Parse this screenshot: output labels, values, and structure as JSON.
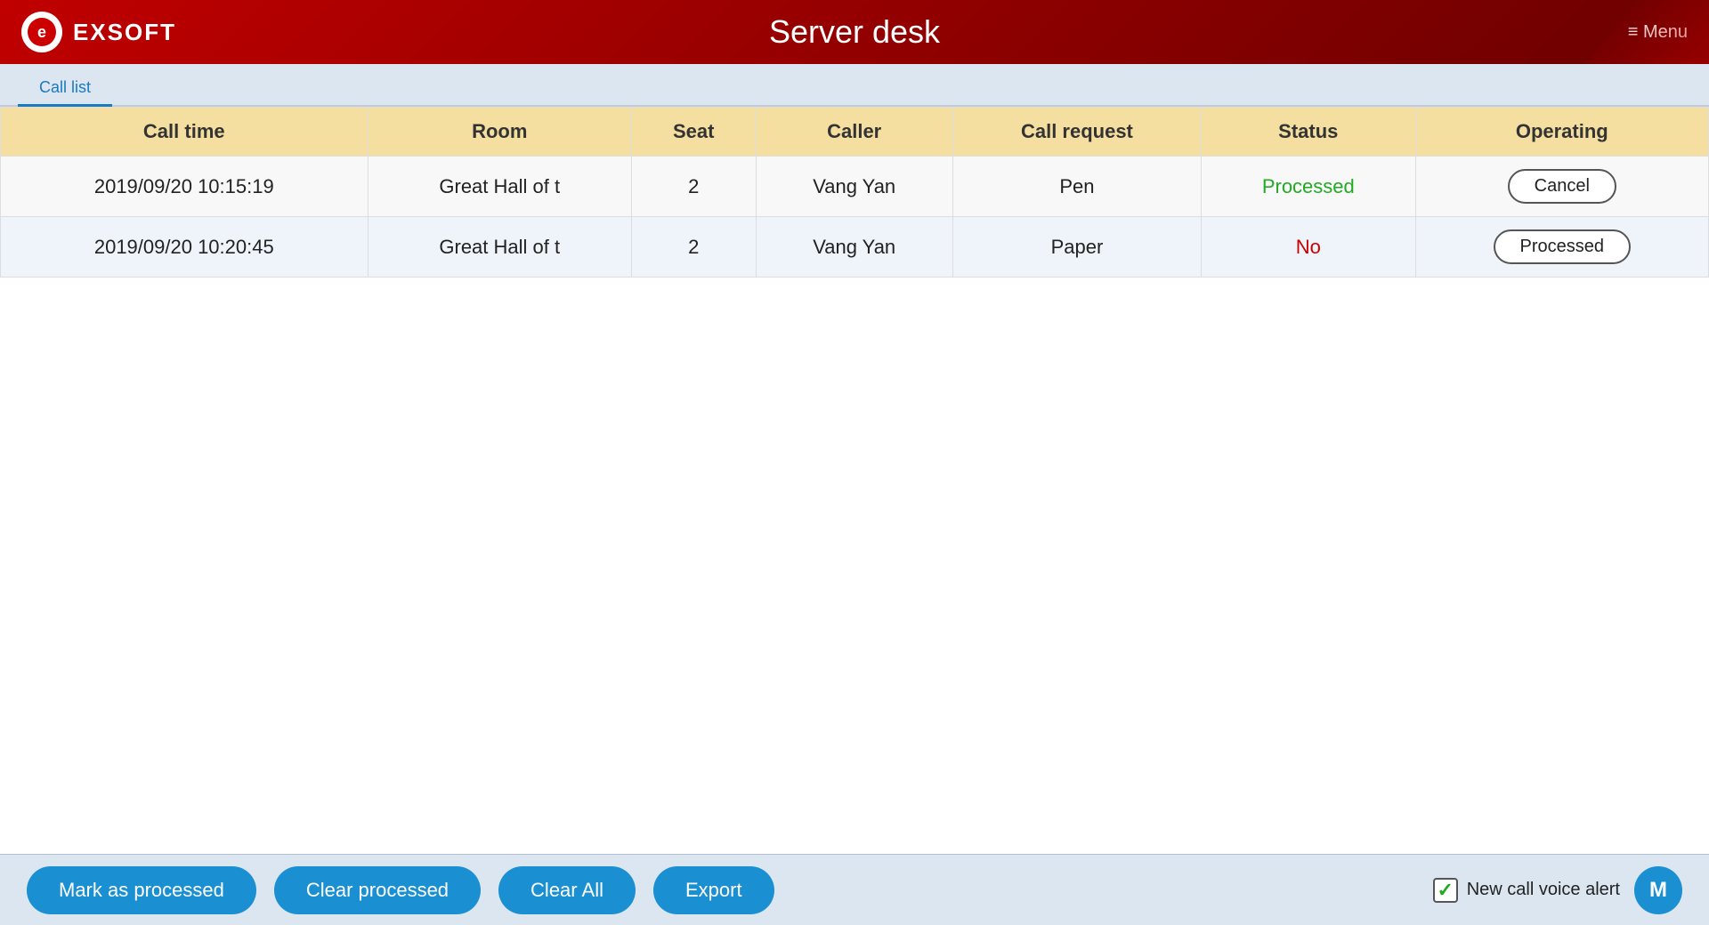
{
  "header": {
    "brand": "EXSOFT",
    "title": "Server desk",
    "menu_label": "≡ Menu"
  },
  "tabs": [
    {
      "id": "call-list",
      "label": "Call list",
      "active": true
    }
  ],
  "table": {
    "columns": [
      "Call time",
      "Room",
      "Seat",
      "Caller",
      "Call request",
      "Status",
      "Operating"
    ],
    "rows": [
      {
        "call_time": "2019/09/20 10:15:19",
        "room": "Great Hall of t",
        "seat": "2",
        "caller": "Vang Yan",
        "call_request": "Pen",
        "status": "Processed",
        "status_type": "processed",
        "operation": "Cancel"
      },
      {
        "call_time": "2019/09/20 10:20:45",
        "room": "Great Hall of t",
        "seat": "2",
        "caller": "Vang Yan",
        "call_request": "Paper",
        "status": "No",
        "status_type": "no",
        "operation": "Processed"
      }
    ]
  },
  "bottom": {
    "btn_mark": "Mark as processed",
    "btn_clear_processed": "Clear processed",
    "btn_clear_all": "Clear All",
    "btn_export": "Export",
    "voice_alert_label": "New call voice alert"
  }
}
